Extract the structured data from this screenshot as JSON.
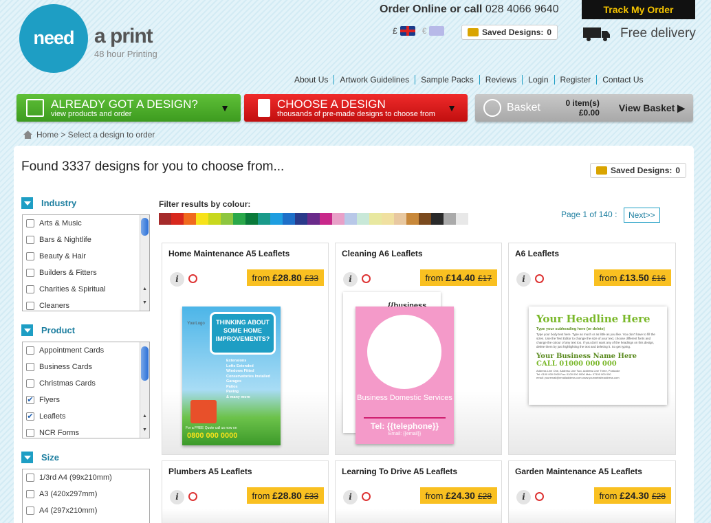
{
  "header": {
    "logo_need": "need",
    "logo_print": "a print",
    "logo_tag": "48 hour Printing",
    "order_text": "Order Online or call",
    "phone": "028 4066 9640",
    "track": "Track My Order",
    "currency_gbp": "£",
    "currency_eur": "€",
    "saved_label": "Saved Designs:",
    "saved_count": "0",
    "free_delivery": "Free delivery"
  },
  "nav": [
    "About Us",
    "Artwork Guidelines",
    "Sample Packs",
    "Reviews",
    "Login",
    "Register",
    "Contact Us"
  ],
  "buttons": {
    "green_title": "ALREADY GOT A DESIGN?",
    "green_sub": "view products and order",
    "red_title": "CHOOSE A DESIGN",
    "red_sub": "thousands of pre-made designs to choose from",
    "basket": "Basket",
    "items": "0 item(s)",
    "total": "£0.00",
    "view_basket": "View Basket"
  },
  "breadcrumb": "Home > Select a design to order",
  "found": "Found 3337 designs for you to choose from...",
  "saved_main": {
    "label": "Saved Designs:",
    "count": "0"
  },
  "filters": {
    "industry": {
      "title": "Industry",
      "items": [
        "Arts & Music",
        "Bars & Nightlife",
        "Beauty & Hair",
        "Builders & Fitters",
        "Charities & Spiritual",
        "Cleaners"
      ]
    },
    "product": {
      "title": "Product",
      "items": [
        "Appointment Cards",
        "Business Cards",
        "Christmas Cards",
        "Flyers",
        "Leaflets",
        "NCR Forms"
      ],
      "checked": [
        false,
        false,
        false,
        true,
        true,
        false
      ]
    },
    "size": {
      "title": "Size",
      "items": [
        "1/3rd A4 (99x210mm)",
        "A3 (420x297mm)",
        "A4 (297x210mm)"
      ]
    }
  },
  "colour": {
    "title": "Filter results by colour:",
    "swatches": [
      "#a52a2a",
      "#d8281e",
      "#f06a1e",
      "#f7e21a",
      "#c8d81e",
      "#8dc63f",
      "#2aa84a",
      "#0a7a3a",
      "#1a9a8a",
      "#1e9ee0",
      "#1e6fc8",
      "#2a3a8a",
      "#6a2a8a",
      "#c8288a",
      "#e8a0c8",
      "#b8c8e8",
      "#c8e8d8",
      "#e8e8a0",
      "#f0e0a0",
      "#e8c8a0",
      "#c8883a",
      "#7a4a1e",
      "#2a2a2a",
      "#aaaaaa",
      "#e8e8e8"
    ]
  },
  "pager": {
    "text": "Page 1 of 140 :",
    "next": "Next>>"
  },
  "cards": [
    {
      "title": "Home Maintenance A5 Leaflets",
      "from": "from",
      "price": "£28.80",
      "was": "£33",
      "thumb": {
        "headline": "THINKING ABOUT SOME HOME IMPROVEMENTS?",
        "list": [
          "Extensions",
          "Lofts Extended",
          "Windows Fitted",
          "Conservatories Installed",
          "Garages",
          "Patios",
          "Paving",
          "& many more"
        ],
        "footer": "For a FREE Quote call us now on",
        "phone": "0800 000 0000",
        "logo": "YourLogo"
      }
    },
    {
      "title": "Cleaning A6 Leaflets",
      "from": "from",
      "price": "£14.40",
      "was": "£17",
      "thumb": {
        "back": "{{business",
        "biz": "Business Domestic Services",
        "tel": "Tel: {{telephone}}",
        "email": "Email: {{email}}"
      }
    },
    {
      "title": "A6 Leaflets",
      "from": "from",
      "price": "£13.50",
      "was": "£16",
      "thumb": {
        "headline": "Your Headline Here",
        "sub": "Type your subheading here (or delete)",
        "body": "Type your body text here. Type as much or as little as you like. You don't have to fill the sizes. Use the Text Editor to change the size of your text, choose different fonts and change the colour of any text too. If you don't want any of the headings on this design, delete them by just highlighting the text and deleting it. So get typing.",
        "biz": "Your Business Name Here",
        "call": "CALL 01000 000 000",
        "addr": "Address Line One, Address Line Two, Address Line Three, Postcode",
        "tel": "Tel: 0100 000 0000   Fax: 0100 000 0000   Mob: 07100 000 000",
        "web": "email: youremail@emailaddress.com   www.yourwebsiteaddress.com"
      }
    },
    {
      "title": "Plumbers A5 Leaflets",
      "from": "from",
      "price": "£28.80",
      "was": "£33"
    },
    {
      "title": "Learning To Drive A5 Leaflets",
      "from": "from",
      "price": "£24.30",
      "was": "£28"
    },
    {
      "title": "Garden Maintenance A5 Leaflets",
      "from": "from",
      "price": "£24.30",
      "was": "£28"
    }
  ]
}
